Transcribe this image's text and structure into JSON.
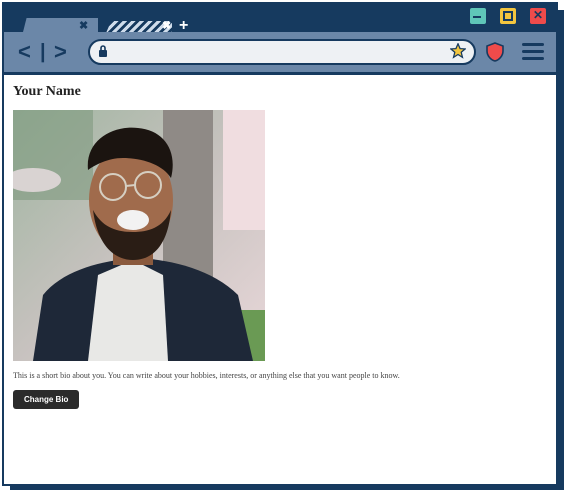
{
  "browser": {
    "tabs": [
      {
        "label": "",
        "active": true
      },
      {
        "label": "",
        "active": false
      }
    ],
    "address_value": "",
    "icons": {
      "close": "close-icon",
      "new_tab": "plus-icon",
      "back": "chevron-left-icon",
      "forward": "chevron-right-icon",
      "lock": "lock-icon",
      "star": "star-icon",
      "shield": "shield-icon",
      "menu": "hamburger-icon"
    },
    "colors": {
      "chrome_dark": "#163a5f",
      "chrome_mid": "#6b87a8",
      "minimize": "#5fc6b8",
      "maximize": "#f3c63f",
      "close": "#ef4b4b"
    }
  },
  "page": {
    "name": "Your Name",
    "bio": "This is a short bio about you. You can write about your hobbies, interests, or anything else that you want people to know.",
    "button_label": "Change Bio"
  }
}
